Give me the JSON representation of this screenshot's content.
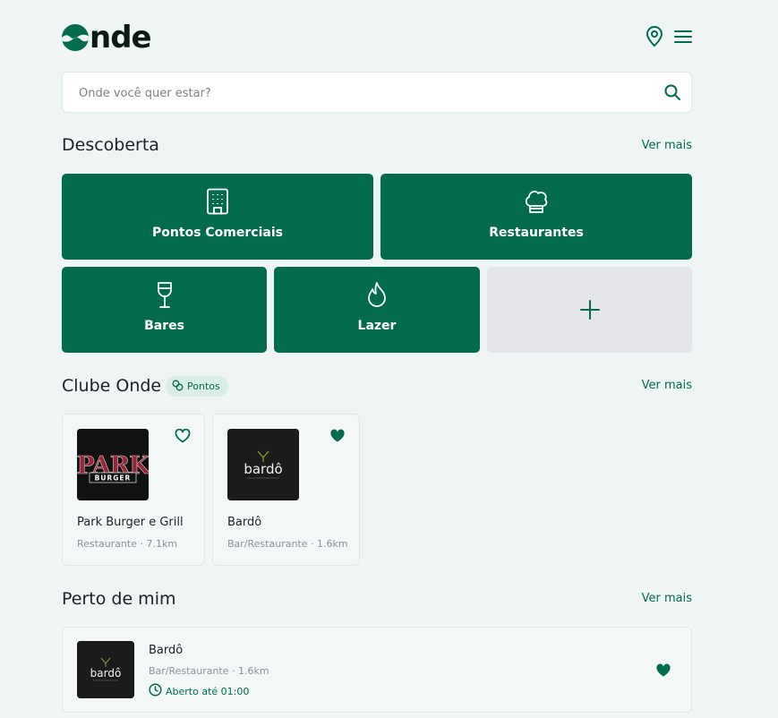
{
  "brand": {
    "name": "nde",
    "color": "#026b4c"
  },
  "header": {
    "icons": [
      "map-pin-icon",
      "menu-icon"
    ]
  },
  "search": {
    "placeholder": "Onde você quer estar?"
  },
  "discovery": {
    "title": "Descoberta",
    "see_more": "Ver mais",
    "categories": [
      {
        "label": "Pontos Comerciais",
        "icon": "building-icon"
      },
      {
        "label": "Restaurantes",
        "icon": "chef-hat-icon"
      },
      {
        "label": "Bares",
        "icon": "wine-glass-icon"
      },
      {
        "label": "Lazer",
        "icon": "flame-icon"
      },
      {
        "label": "",
        "icon": "plus-icon"
      }
    ]
  },
  "club": {
    "title": "Clube Onde",
    "badge": "Pontos",
    "see_more": "Ver mais",
    "items": [
      {
        "name": "Park Burger e Grill",
        "meta": "Restaurante · 7.1km",
        "logo_text": "PARK",
        "logo_sub": "BURGER",
        "favorite": false
      },
      {
        "name": "Bardô",
        "meta": "Bar/Restaurante · 1.6km",
        "logo_text": "bardô",
        "favorite": true
      }
    ]
  },
  "nearby": {
    "title": "Perto de mim",
    "see_more": "Ver mais",
    "items": [
      {
        "name": "Bardô",
        "meta": "Bar/Restaurante · 1.6km",
        "status": "Aberto até 01:00",
        "logo_text": "bardô",
        "favorite": true
      }
    ]
  },
  "colors": {
    "primary": "#026b4c",
    "background": "#eff4f4",
    "tile_add": "#e4e6e9"
  }
}
